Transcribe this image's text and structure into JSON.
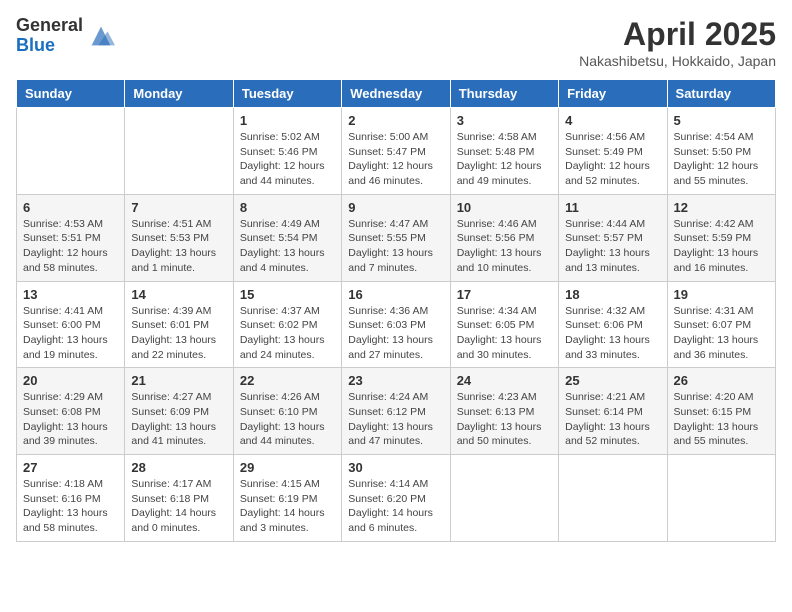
{
  "header": {
    "logo_general": "General",
    "logo_blue": "Blue",
    "title": "April 2025",
    "subtitle": "Nakashibetsu, Hokkaido, Japan"
  },
  "weekdays": [
    "Sunday",
    "Monday",
    "Tuesday",
    "Wednesday",
    "Thursday",
    "Friday",
    "Saturday"
  ],
  "weeks": [
    [
      {
        "day": "",
        "sunrise": "",
        "sunset": "",
        "daylight": ""
      },
      {
        "day": "",
        "sunrise": "",
        "sunset": "",
        "daylight": ""
      },
      {
        "day": "1",
        "sunrise": "Sunrise: 5:02 AM",
        "sunset": "Sunset: 5:46 PM",
        "daylight": "Daylight: 12 hours and 44 minutes."
      },
      {
        "day": "2",
        "sunrise": "Sunrise: 5:00 AM",
        "sunset": "Sunset: 5:47 PM",
        "daylight": "Daylight: 12 hours and 46 minutes."
      },
      {
        "day": "3",
        "sunrise": "Sunrise: 4:58 AM",
        "sunset": "Sunset: 5:48 PM",
        "daylight": "Daylight: 12 hours and 49 minutes."
      },
      {
        "day": "4",
        "sunrise": "Sunrise: 4:56 AM",
        "sunset": "Sunset: 5:49 PM",
        "daylight": "Daylight: 12 hours and 52 minutes."
      },
      {
        "day": "5",
        "sunrise": "Sunrise: 4:54 AM",
        "sunset": "Sunset: 5:50 PM",
        "daylight": "Daylight: 12 hours and 55 minutes."
      }
    ],
    [
      {
        "day": "6",
        "sunrise": "Sunrise: 4:53 AM",
        "sunset": "Sunset: 5:51 PM",
        "daylight": "Daylight: 12 hours and 58 minutes."
      },
      {
        "day": "7",
        "sunrise": "Sunrise: 4:51 AM",
        "sunset": "Sunset: 5:53 PM",
        "daylight": "Daylight: 13 hours and 1 minute."
      },
      {
        "day": "8",
        "sunrise": "Sunrise: 4:49 AM",
        "sunset": "Sunset: 5:54 PM",
        "daylight": "Daylight: 13 hours and 4 minutes."
      },
      {
        "day": "9",
        "sunrise": "Sunrise: 4:47 AM",
        "sunset": "Sunset: 5:55 PM",
        "daylight": "Daylight: 13 hours and 7 minutes."
      },
      {
        "day": "10",
        "sunrise": "Sunrise: 4:46 AM",
        "sunset": "Sunset: 5:56 PM",
        "daylight": "Daylight: 13 hours and 10 minutes."
      },
      {
        "day": "11",
        "sunrise": "Sunrise: 4:44 AM",
        "sunset": "Sunset: 5:57 PM",
        "daylight": "Daylight: 13 hours and 13 minutes."
      },
      {
        "day": "12",
        "sunrise": "Sunrise: 4:42 AM",
        "sunset": "Sunset: 5:59 PM",
        "daylight": "Daylight: 13 hours and 16 minutes."
      }
    ],
    [
      {
        "day": "13",
        "sunrise": "Sunrise: 4:41 AM",
        "sunset": "Sunset: 6:00 PM",
        "daylight": "Daylight: 13 hours and 19 minutes."
      },
      {
        "day": "14",
        "sunrise": "Sunrise: 4:39 AM",
        "sunset": "Sunset: 6:01 PM",
        "daylight": "Daylight: 13 hours and 22 minutes."
      },
      {
        "day": "15",
        "sunrise": "Sunrise: 4:37 AM",
        "sunset": "Sunset: 6:02 PM",
        "daylight": "Daylight: 13 hours and 24 minutes."
      },
      {
        "day": "16",
        "sunrise": "Sunrise: 4:36 AM",
        "sunset": "Sunset: 6:03 PM",
        "daylight": "Daylight: 13 hours and 27 minutes."
      },
      {
        "day": "17",
        "sunrise": "Sunrise: 4:34 AM",
        "sunset": "Sunset: 6:05 PM",
        "daylight": "Daylight: 13 hours and 30 minutes."
      },
      {
        "day": "18",
        "sunrise": "Sunrise: 4:32 AM",
        "sunset": "Sunset: 6:06 PM",
        "daylight": "Daylight: 13 hours and 33 minutes."
      },
      {
        "day": "19",
        "sunrise": "Sunrise: 4:31 AM",
        "sunset": "Sunset: 6:07 PM",
        "daylight": "Daylight: 13 hours and 36 minutes."
      }
    ],
    [
      {
        "day": "20",
        "sunrise": "Sunrise: 4:29 AM",
        "sunset": "Sunset: 6:08 PM",
        "daylight": "Daylight: 13 hours and 39 minutes."
      },
      {
        "day": "21",
        "sunrise": "Sunrise: 4:27 AM",
        "sunset": "Sunset: 6:09 PM",
        "daylight": "Daylight: 13 hours and 41 minutes."
      },
      {
        "day": "22",
        "sunrise": "Sunrise: 4:26 AM",
        "sunset": "Sunset: 6:10 PM",
        "daylight": "Daylight: 13 hours and 44 minutes."
      },
      {
        "day": "23",
        "sunrise": "Sunrise: 4:24 AM",
        "sunset": "Sunset: 6:12 PM",
        "daylight": "Daylight: 13 hours and 47 minutes."
      },
      {
        "day": "24",
        "sunrise": "Sunrise: 4:23 AM",
        "sunset": "Sunset: 6:13 PM",
        "daylight": "Daylight: 13 hours and 50 minutes."
      },
      {
        "day": "25",
        "sunrise": "Sunrise: 4:21 AM",
        "sunset": "Sunset: 6:14 PM",
        "daylight": "Daylight: 13 hours and 52 minutes."
      },
      {
        "day": "26",
        "sunrise": "Sunrise: 4:20 AM",
        "sunset": "Sunset: 6:15 PM",
        "daylight": "Daylight: 13 hours and 55 minutes."
      }
    ],
    [
      {
        "day": "27",
        "sunrise": "Sunrise: 4:18 AM",
        "sunset": "Sunset: 6:16 PM",
        "daylight": "Daylight: 13 hours and 58 minutes."
      },
      {
        "day": "28",
        "sunrise": "Sunrise: 4:17 AM",
        "sunset": "Sunset: 6:18 PM",
        "daylight": "Daylight: 14 hours and 0 minutes."
      },
      {
        "day": "29",
        "sunrise": "Sunrise: 4:15 AM",
        "sunset": "Sunset: 6:19 PM",
        "daylight": "Daylight: 14 hours and 3 minutes."
      },
      {
        "day": "30",
        "sunrise": "Sunrise: 4:14 AM",
        "sunset": "Sunset: 6:20 PM",
        "daylight": "Daylight: 14 hours and 6 minutes."
      },
      {
        "day": "",
        "sunrise": "",
        "sunset": "",
        "daylight": ""
      },
      {
        "day": "",
        "sunrise": "",
        "sunset": "",
        "daylight": ""
      },
      {
        "day": "",
        "sunrise": "",
        "sunset": "",
        "daylight": ""
      }
    ]
  ]
}
